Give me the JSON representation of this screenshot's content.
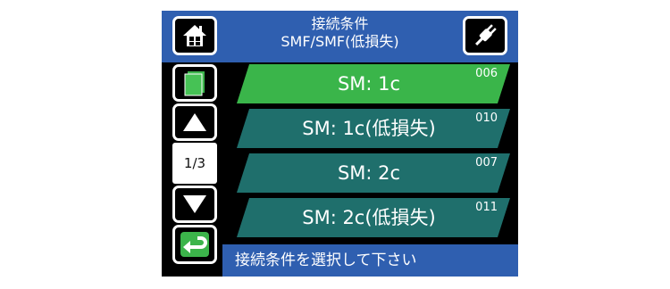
{
  "header": {
    "title_line1": "接続条件",
    "title_line2": "SMF/SMF(低損失)"
  },
  "icons": {
    "home": "home-icon",
    "power": "power-plug-icon",
    "book": "book-icon",
    "up": "up-arrow-icon",
    "down": "down-arrow-icon",
    "back": "return-arrow-icon"
  },
  "pager": {
    "page": "1/3"
  },
  "items": [
    {
      "label": "SM: 1c",
      "code": "006",
      "selected": true
    },
    {
      "label": "SM: 1c(低損失)",
      "code": "010",
      "selected": false
    },
    {
      "label": "SM: 2c",
      "code": "007",
      "selected": false
    },
    {
      "label": "SM: 2c(低損失)",
      "code": "011",
      "selected": false
    }
  ],
  "footer": {
    "text": "接続条件を選択して下さい"
  },
  "colors": {
    "header_blue": "#2f5fb0",
    "selected_green": "#3ab54a",
    "item_teal": "#1f6f6c",
    "book_green": "#3cb44b"
  }
}
